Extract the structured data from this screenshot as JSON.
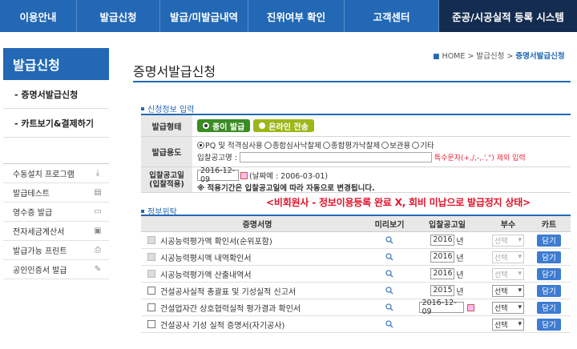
{
  "nav": {
    "items": [
      "이용안내",
      "발급신청",
      "발급/미발급내역",
      "진위여부 확인",
      "고객센터",
      "준공/시공실적 등록 시스템"
    ]
  },
  "sidebar": {
    "header": "발급신청",
    "menu": [
      "- 증명서발급신청",
      "- 카트보기&결제하기"
    ],
    "tools": [
      {
        "label": "수동설치 프로그램",
        "icon": "download-icon"
      },
      {
        "label": "발급테스트",
        "icon": "document-icon"
      },
      {
        "label": "영수증 발급",
        "icon": "chat-icon"
      },
      {
        "label": "전자세금계산서",
        "icon": "print-document-icon"
      },
      {
        "label": "발급가능 프린트",
        "icon": "printer-icon"
      },
      {
        "label": "공인인증서 발급",
        "icon": "edit-icon"
      }
    ]
  },
  "breadcrumb": {
    "home": "HOME",
    "sep": ">",
    "level1": "발급신청",
    "current": "증명서발급신청"
  },
  "page_title": "증명서발급신청",
  "section1": {
    "label": "신청정보 입력"
  },
  "form": {
    "issue_type_label": "발급형태",
    "issue_paper": "종이 발급",
    "issue_online": "온라인 전송",
    "purpose_label": "발급용도",
    "purpose_options": [
      "PQ 및 적격심사용",
      "종합심사낙찰제",
      "종합평가낙찰제",
      "보관용",
      "기타"
    ],
    "notice_name_label": "입찰공고명 :",
    "notice_warning": "특수문자(+,/,-,.',\") 제외 입력",
    "bid_date_label": "입찰공고일\n(입찰적용)",
    "bid_date_value": "2016-12-09",
    "bid_date_example": "(날짜예 : 2006-03-01)",
    "bid_date_note": "※ 적용기간은 입찰공고일에 따라 자동으로 변경됩니다."
  },
  "annotation": "<비회원사 - 정보이용등록 완료 X, 회비 미납으로 발급정지 상태>",
  "section2": {
    "label": "정부위탁"
  },
  "table": {
    "headers": [
      "증명서명",
      "미리보기",
      "입찰공고일",
      "부수",
      "카트"
    ],
    "rows": [
      {
        "name": "시공능력평가액 확인서(순위포함)",
        "year": "2016",
        "unit": "년",
        "select": "선택",
        "cart": "담기",
        "disabled": true
      },
      {
        "name": "시공능력평시액 내역확인서",
        "year": "2016",
        "unit": "년",
        "select": "선택",
        "cart": "담기",
        "disabled": true
      },
      {
        "name": "시공능력평가액 산출내역서",
        "year": "2016",
        "unit": "년",
        "select": "선택",
        "cart": "담기",
        "disabled": true
      },
      {
        "name": "건설공사실적 총괄표 및 기성실적 신고서",
        "year": "2015",
        "unit": "년",
        "select": "선택",
        "cart": "담기",
        "disabled": false
      },
      {
        "name": "건설업자간 상호협력실적 평가결과 확인서",
        "date": "2016-12-09",
        "select": "선택",
        "cart": "담기",
        "disabled": false
      },
      {
        "name": "건설공사 기성 실적 증명서(자기공사)",
        "select": "선택",
        "cart": "담기",
        "disabled": false
      }
    ]
  }
}
